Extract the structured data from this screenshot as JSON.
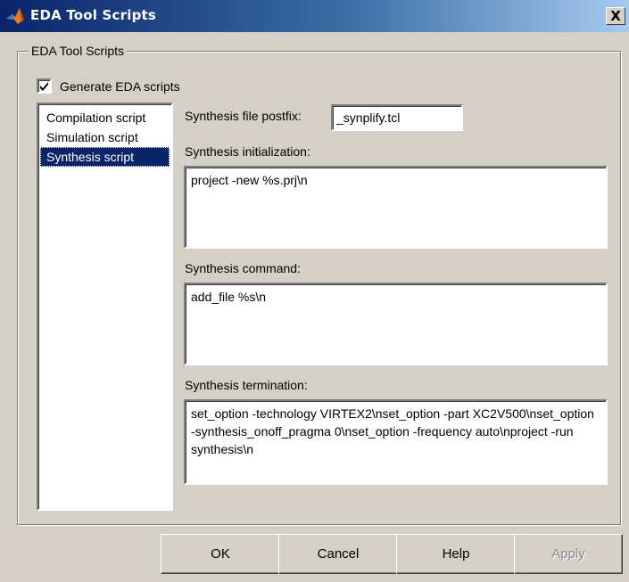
{
  "window": {
    "title": "EDA Tool Scripts",
    "close_glyph": "X",
    "icon": "matlab-logo-icon"
  },
  "group": {
    "legend": "EDA Tool Scripts"
  },
  "generate_checkbox": {
    "label": "Generate EDA scripts",
    "checked": true
  },
  "script_list": {
    "items": [
      "Compilation script",
      "Simulation script",
      "Synthesis script"
    ],
    "selected": "Synthesis script"
  },
  "synthesis": {
    "postfix_label": "Synthesis file postfix:",
    "postfix_value": "_synplify.tcl",
    "init_label": "Synthesis initialization:",
    "init_value": "project -new %s.prj\\n",
    "command_label": "Synthesis command:",
    "command_value": "add_file %s\\n",
    "termination_label": "Synthesis termination:",
    "termination_value": "set_option -technology VIRTEX2\\nset_option -part XC2V500\\nset_option -synthesis_onoff_pragma 0\\nset_option -frequency auto\\nproject -run synthesis\\n"
  },
  "buttons": {
    "ok": "OK",
    "cancel": "Cancel",
    "help": "Help",
    "apply": "Apply"
  },
  "colors": {
    "titlebar": "#0a246a",
    "selection": "#0a246a",
    "face": "#d4d0c8"
  }
}
